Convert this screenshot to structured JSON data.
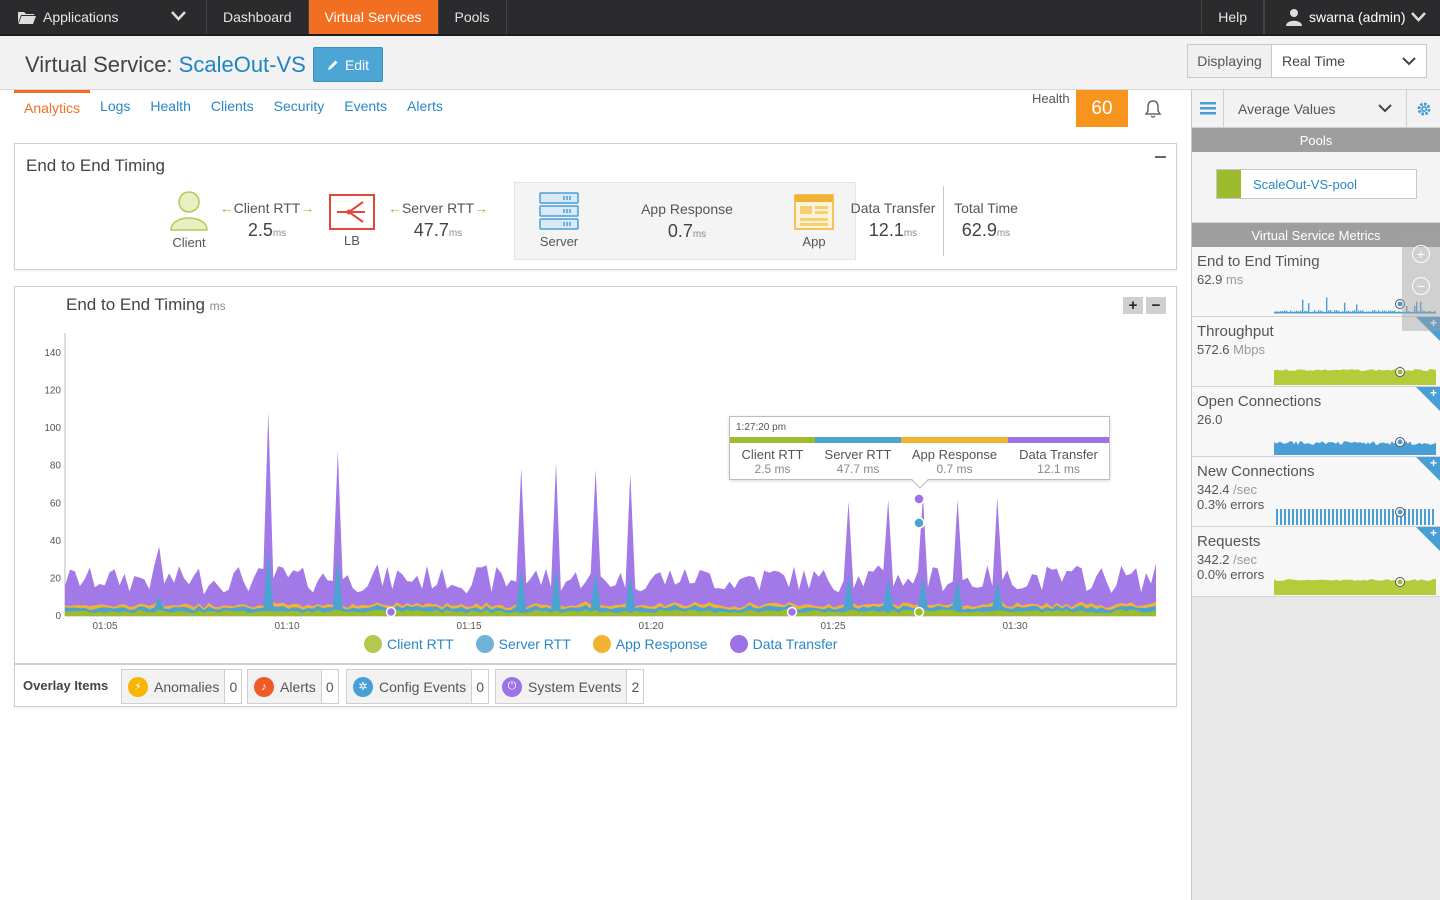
{
  "topnav": {
    "apps_label": "Applications",
    "items": [
      {
        "label": "Dashboard",
        "active": false
      },
      {
        "label": "Virtual Services",
        "active": true
      },
      {
        "label": "Pools",
        "active": false
      }
    ],
    "help_label": "Help",
    "user_label": "swarna (admin)"
  },
  "header": {
    "title_prefix": "Virtual Service:",
    "vs_name": "ScaleOut-VS",
    "edit_label": "Edit",
    "displaying_label": "Displaying",
    "displaying_value": "Real Time"
  },
  "tabs": [
    "Analytics",
    "Logs",
    "Health",
    "Clients",
    "Security",
    "Events",
    "Alerts"
  ],
  "health": {
    "label": "Health",
    "score": "60"
  },
  "e2e": {
    "title": "End to End Timing",
    "client_label": "Client",
    "lb_label": "LB",
    "server_label": "Server",
    "app_label": "App",
    "client_rtt": {
      "label": "Client RTT",
      "value": "2.5",
      "unit": "ms"
    },
    "server_rtt": {
      "label": "Server RTT",
      "value": "47.7",
      "unit": "ms"
    },
    "app_response": {
      "label": "App Response",
      "value": "0.7",
      "unit": "ms"
    },
    "data_transfer": {
      "label": "Data Transfer",
      "value": "12.1",
      "unit": "ms"
    },
    "total_time": {
      "label": "Total Time",
      "value": "62.9",
      "unit": "ms"
    }
  },
  "chart": {
    "title": "End to End Timing",
    "unit": "ms",
    "tooltip": {
      "time": "1:27:20 pm",
      "items": [
        {
          "label": "Client RTT",
          "value": "2.5 ms"
        },
        {
          "label": "Server RTT",
          "value": "47.7 ms"
        },
        {
          "label": "App Response",
          "value": "0.7 ms"
        },
        {
          "label": "Data Transfer",
          "value": "12.1 ms"
        }
      ]
    }
  },
  "chart_data": {
    "type": "area",
    "title": "End to End Timing",
    "ylabel": "ms",
    "ylim": [
      0,
      140
    ],
    "yticks": [
      0,
      20,
      40,
      60,
      80,
      100,
      120,
      140
    ],
    "xticks": [
      "01:05",
      "01:10",
      "01:15",
      "01:20",
      "01:25",
      "01:30"
    ],
    "stacked": true,
    "series": [
      {
        "name": "Client RTT",
        "color": "#9cbc2d",
        "typical": 2.5
      },
      {
        "name": "Server RTT",
        "color": "#4aa3d0",
        "typical": 2.0
      },
      {
        "name": "App Response",
        "color": "#f2b233",
        "typical": 1.5
      },
      {
        "name": "Data Transfer",
        "color": "#9d72e6",
        "typical": 14
      }
    ],
    "spikes": [
      {
        "time": "01:06",
        "value": 37
      },
      {
        "time": "01:09",
        "value": 109
      },
      {
        "time": "01:11",
        "value": 88
      },
      {
        "time": "01:16",
        "value": 79
      },
      {
        "time": "01:17",
        "value": 82
      },
      {
        "time": "01:18",
        "value": 78
      },
      {
        "time": "01:19",
        "value": 76
      },
      {
        "time": "01:25",
        "value": 61
      },
      {
        "time": "01:26",
        "value": 62
      },
      {
        "time": "01:27",
        "value": 64
      },
      {
        "time": "01:28",
        "value": 62
      },
      {
        "time": "01:29",
        "value": 63
      }
    ],
    "legend": [
      "Client RTT",
      "Server RTT",
      "App Response",
      "Data Transfer"
    ],
    "legend_position": "bottom",
    "grid": false
  },
  "overlay": {
    "title": "Overlay Items",
    "items": [
      {
        "label": "Anomalies",
        "count": "0",
        "color": "#f7b500",
        "icon": "lightning-icon"
      },
      {
        "label": "Alerts",
        "count": "0",
        "color": "#f05a28",
        "icon": "bell-icon"
      },
      {
        "label": "Config Events",
        "count": "0",
        "color": "#4a9ed6",
        "icon": "gear-icon"
      },
      {
        "label": "System Events",
        "count": "2",
        "color": "#9d72e6",
        "icon": "power-icon"
      }
    ]
  },
  "rpanel": {
    "avg_label": "Average Values",
    "pools_header": "Pools",
    "pool_name": "ScaleOut-VS-pool",
    "metrics_header": "Virtual Service Metrics",
    "metrics": [
      {
        "name": "End to End Timing",
        "value": "62.9",
        "unit": "ms",
        "sub": "",
        "color": "#4a9ed6"
      },
      {
        "name": "Throughput",
        "value": "572.6",
        "unit": "Mbps",
        "sub": "",
        "color": "#b4cc3b"
      },
      {
        "name": "Open Connections",
        "value": "26.0",
        "unit": "",
        "sub": "",
        "color": "#4a9ed6"
      },
      {
        "name": "New Connections",
        "value": "342.4",
        "unit": "/sec",
        "sub": "0.3% errors",
        "color": "#4a9ed6"
      },
      {
        "name": "Requests",
        "value": "342.2",
        "unit": "/sec",
        "sub": "0.0% errors",
        "color": "#b4cc3b"
      }
    ]
  }
}
